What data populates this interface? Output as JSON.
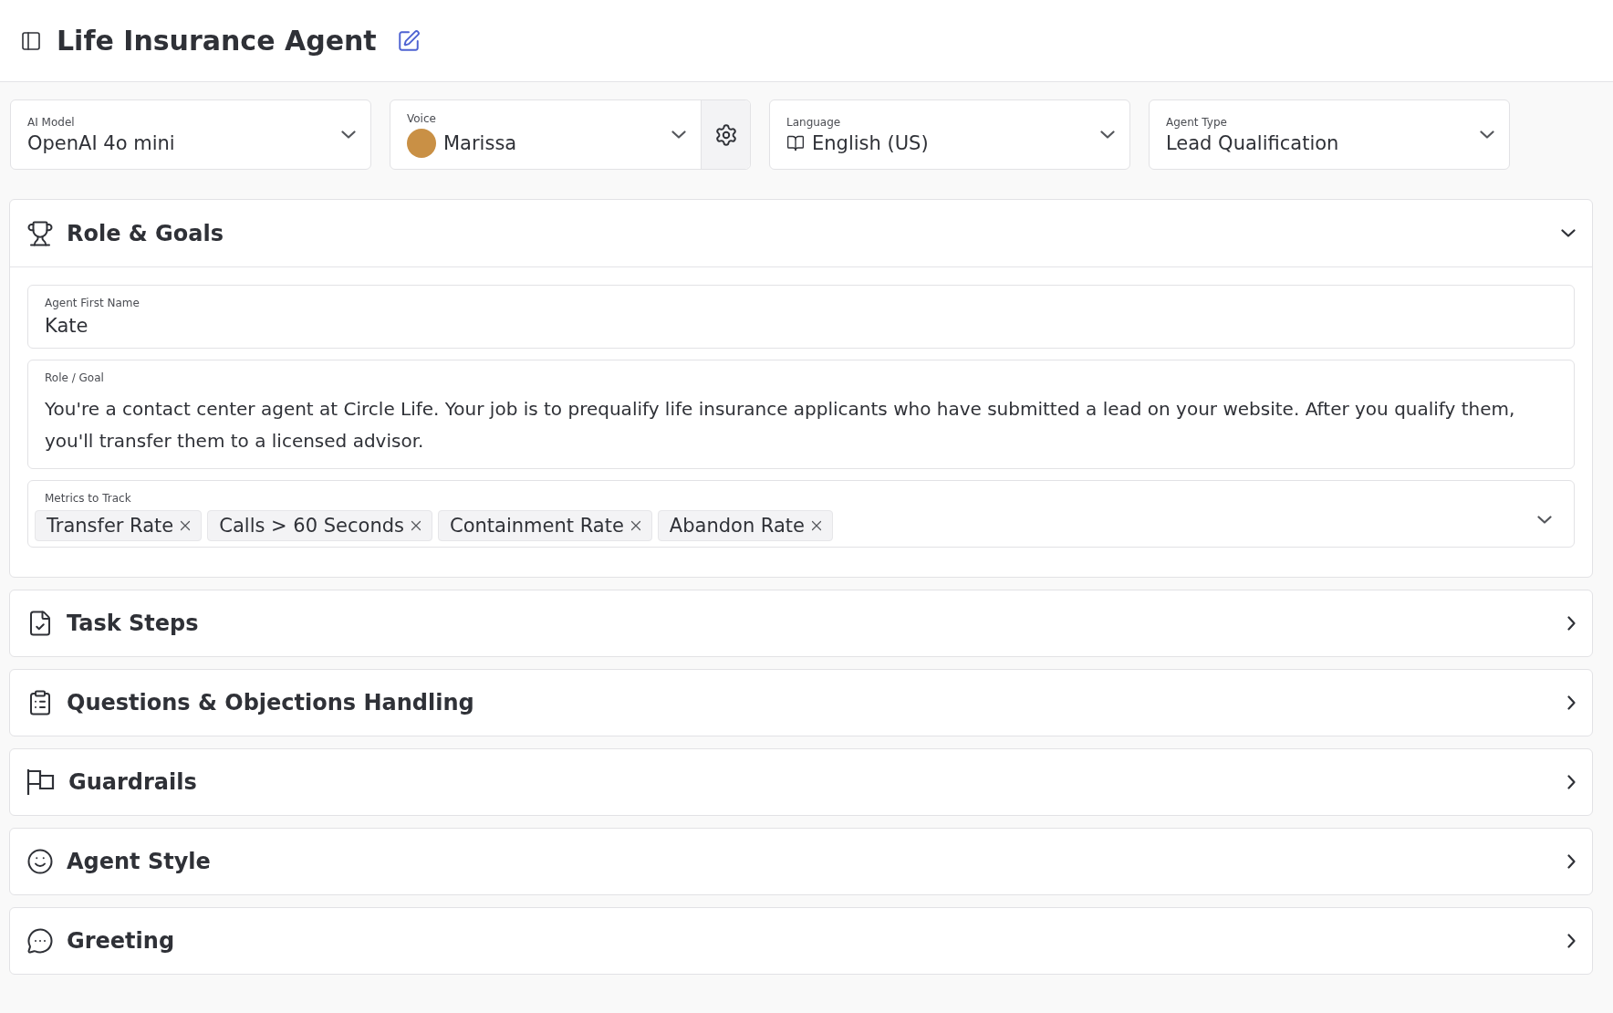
{
  "header": {
    "title": "Life Insurance Agent"
  },
  "selectors": [
    {
      "kind": "plain",
      "label": "AI Model",
      "value": "OpenAI 4o mini"
    },
    {
      "kind": "voice",
      "label": "Voice",
      "value": "Marissa"
    },
    {
      "kind": "language",
      "label": "Language",
      "value": "English (US)"
    },
    {
      "kind": "plain",
      "label": "Agent Type",
      "value": "Lead Qualification"
    }
  ],
  "sections": [
    {
      "title": "Role & Goals",
      "expanded": true,
      "fields": [
        {
          "kind": "input",
          "label": "Agent First Name",
          "value": "Kate"
        },
        {
          "kind": "textarea",
          "label": "Role / Goal",
          "value": "You're a contact center agent at Circle Life. Your job is to prequalify life insurance applicants who have submitted a lead on your website. After you qualify them, you'll transfer them to a licensed advisor."
        },
        {
          "kind": "tags",
          "label": "Metrics to Track",
          "tags": [
            "Transfer Rate",
            "Calls > 60 Seconds",
            "Containment Rate",
            "Abandon Rate"
          ]
        }
      ]
    },
    {
      "title": "Task Steps",
      "expanded": false
    },
    {
      "title": "Questions & Objections Handling",
      "expanded": false
    },
    {
      "title": "Guardrails",
      "expanded": false
    },
    {
      "title": "Agent Style",
      "expanded": false
    },
    {
      "title": "Greeting",
      "expanded": false
    }
  ]
}
